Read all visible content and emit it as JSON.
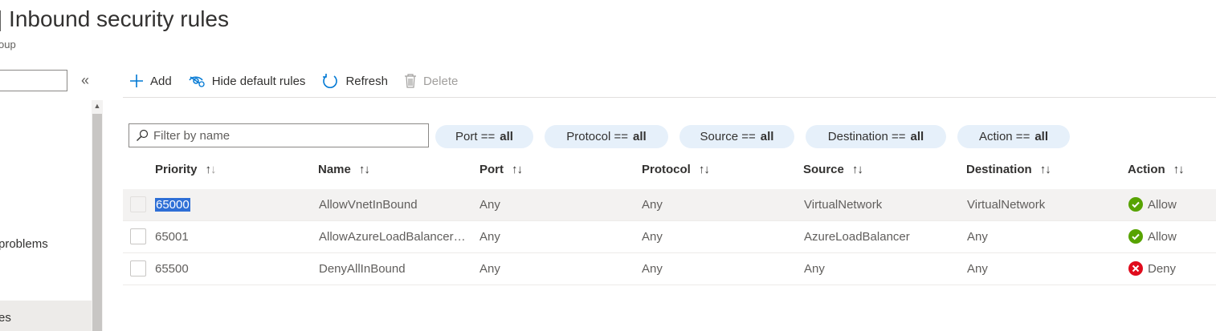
{
  "page": {
    "title": "| Inbound security rules",
    "subtitle": "oup"
  },
  "left_nav": {
    "collapse_glyph": "«",
    "items": [
      {
        "label": "problems"
      },
      {
        "label": "es",
        "selected": true
      }
    ]
  },
  "toolbar": {
    "add_label": "Add",
    "hide_default_label": "Hide default rules",
    "refresh_label": "Refresh",
    "delete_label": "Delete",
    "delete_disabled": true
  },
  "filter": {
    "placeholder": "Filter by name",
    "icon": "search-icon"
  },
  "pills": [
    {
      "key": "Port ==",
      "value": "all"
    },
    {
      "key": "Protocol ==",
      "value": "all"
    },
    {
      "key": "Source ==",
      "value": "all"
    },
    {
      "key": "Destination ==",
      "value": "all"
    },
    {
      "key": "Action ==",
      "value": "all"
    }
  ],
  "table": {
    "sort_glyph": "↑↓",
    "columns": [
      "Priority",
      "Name",
      "Port",
      "Protocol",
      "Source",
      "Destination",
      "Action"
    ],
    "rows": [
      {
        "priority": "65000",
        "name": "AllowVnetInBound",
        "port": "Any",
        "protocol": "Any",
        "source": "VirtualNetwork",
        "destination": "VirtualNetwork",
        "action": "Allow",
        "action_type": "allow",
        "highlighted": true
      },
      {
        "priority": "65001",
        "name": "AllowAzureLoadBalancer…",
        "port": "Any",
        "protocol": "Any",
        "source": "AzureLoadBalancer",
        "destination": "Any",
        "action": "Allow",
        "action_type": "allow"
      },
      {
        "priority": "65500",
        "name": "DenyAllInBound",
        "port": "Any",
        "protocol": "Any",
        "source": "Any",
        "destination": "Any",
        "action": "Deny",
        "action_type": "deny"
      }
    ]
  },
  "colors": {
    "allow": "#57a300",
    "deny": "#e00b1c",
    "accent": "#0078d4",
    "pill_bg": "#e6f0fa",
    "selection": "#2e6fd6"
  }
}
